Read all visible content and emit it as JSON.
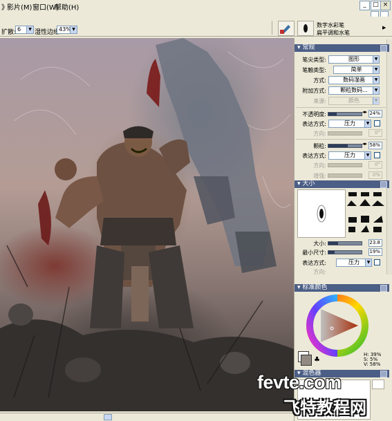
{
  "menubar": {
    "items": [
      "》",
      "影片(M)",
      "窗口(W)",
      "帮助(H)"
    ],
    "window_buttons": [
      "_",
      "□",
      "×"
    ]
  },
  "propbar": {
    "spread_label": "扩散:",
    "spread_value": "6",
    "wet_edge_label": "湿性边缘:",
    "wet_edge_value": "43%",
    "brush_category": "数字水彩笔",
    "brush_variant": "扁平调和水笔"
  },
  "panels": {
    "general": {
      "title": "常规",
      "rows": [
        {
          "label": "笔尖类型:",
          "value": "图形"
        },
        {
          "label": "笔触类型:",
          "value": "简单"
        },
        {
          "label": "方式:",
          "value": "数码湿画"
        },
        {
          "label": "附加方式:",
          "value": "颗粒数码..."
        },
        {
          "label": "来源:",
          "value": "颜色",
          "disabled": true
        }
      ],
      "opacity": {
        "label": "不透明度:",
        "value": "24%",
        "fraction": 0.24
      },
      "opacity_expr": {
        "label": "表达方式:",
        "value": "压力"
      },
      "opacity_dir": {
        "label": "方向:",
        "value": "0°"
      },
      "grain": {
        "label": "颗粒:",
        "value": "58%",
        "fraction": 0.58
      },
      "grain_expr": {
        "label": "表达方式:",
        "value": "压力"
      },
      "grain_dir": {
        "label": "方向:",
        "value": "0°"
      },
      "enhance": {
        "label": "增强:",
        "value": "0%"
      }
    },
    "size": {
      "title": "大小",
      "size": {
        "label": "大小:",
        "value": "23.8"
      },
      "min_size": {
        "label": "最小尺寸:",
        "value": "19%"
      },
      "size_expr": {
        "label": "表达方式:",
        "value": "压力"
      },
      "dir_label": "方向:"
    },
    "color": {
      "title": "标准颜色",
      "hsv": [
        "H: 39%",
        "S: 5%",
        "V: 58%"
      ]
    },
    "mixer": {
      "title": "混色器"
    }
  },
  "watermark": {
    "line1": "fevte.com",
    "line2": "飞特教程网"
  }
}
